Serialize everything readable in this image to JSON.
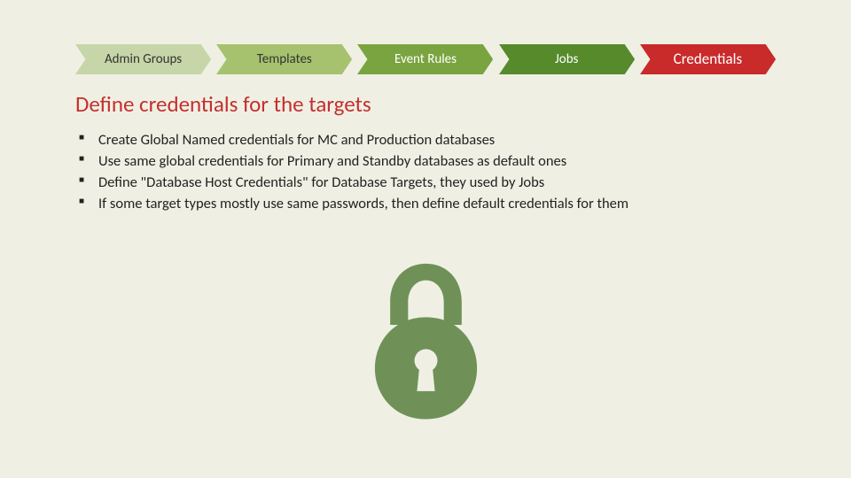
{
  "chevrons": [
    {
      "label": "Admin Groups",
      "fill": "#c7d6a8",
      "text_style": "dim"
    },
    {
      "label": "Templates",
      "fill": "#a6c26e",
      "text_style": "dim"
    },
    {
      "label": "Event Rules",
      "fill": "#7aa43f",
      "text_style": "mid"
    },
    {
      "label": "Jobs",
      "fill": "#568a2b",
      "text_style": "mid"
    },
    {
      "label": "Credentials",
      "fill": "#c92a2a",
      "text_style": "active"
    }
  ],
  "heading": "Define credentials for the targets",
  "bullets": [
    "Create Global Named credentials for MC and Production databases",
    "Use same global credentials for Primary and Standby databases as default ones",
    "Define \"Database Host Credentials\" for Database Targets, they used by Jobs",
    "If some target types mostly use same passwords, then define default credentials for them"
  ],
  "icon": {
    "name": "lock-icon",
    "color": "#6f9158"
  }
}
